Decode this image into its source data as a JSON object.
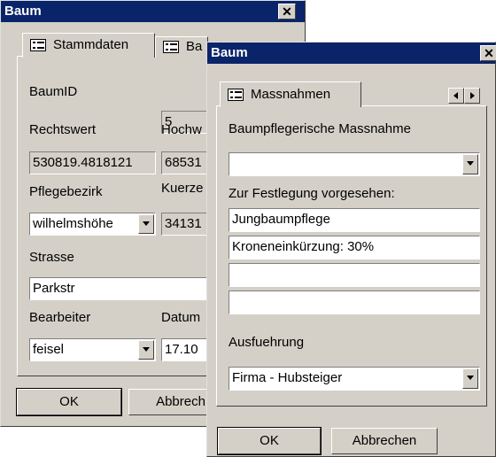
{
  "back_window": {
    "title": "Baum",
    "tabs": [
      "Stammdaten",
      "Ba"
    ],
    "labels": {
      "baumid": "BaumID",
      "rechtswert": "Rechtswert",
      "hochwert": "Hochw",
      "pflegebezirk": "Pflegebezirk",
      "kuerzel": "Kuerze",
      "strasse": "Strasse",
      "bearbeiter": "Bearbeiter",
      "datum": "Datum"
    },
    "values": {
      "baumid": "5",
      "rechtswert": "530819.4818121",
      "hochwert": "68531",
      "pflegebezirk": "wilhelmshöhe",
      "kuerzel": "34131",
      "strasse": "Parkstr",
      "bearbeiter": "feisel",
      "datum": "17.10"
    },
    "buttons": {
      "ok": "OK",
      "abbrechen": "Abbrech"
    }
  },
  "front_window": {
    "title": "Baum",
    "tab": "Massnahmen",
    "labels": {
      "massnahme": "Baumpflegerische Massnahme",
      "vorgesehen": "Zur Festlegung vorgesehen:",
      "ausfuehrung": "Ausfuehrung"
    },
    "massnahme_value": "",
    "vorgesehen_items": [
      "Jungbaumpflege",
      "Kroneneinkürzung: 30%",
      "",
      ""
    ],
    "ausfuehrung_value": "Firma - Hubsteiger",
    "buttons": {
      "ok": "OK",
      "abbrechen": "Abbrechen"
    }
  }
}
